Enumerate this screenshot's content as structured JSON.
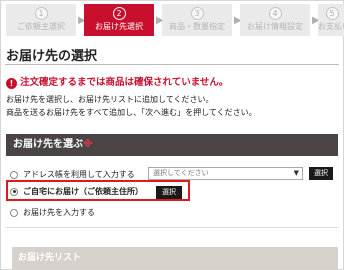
{
  "stepper": {
    "steps": [
      {
        "num": "1",
        "label": "ご依頼主選択"
      },
      {
        "num": "2",
        "label": "お届け先選択"
      },
      {
        "num": "3",
        "label": "商品・数量指定"
      },
      {
        "num": "4",
        "label": "お届け情報設定"
      },
      {
        "num": "5",
        "label": "お支払い方"
      }
    ],
    "active_index": 1
  },
  "page_title": "お届け先の選択",
  "warning": {
    "icon": "exclamation-icon",
    "text": "注文確定するまでは商品は確保されていません。"
  },
  "description": {
    "line1": "お届け先を選択し、お届け先リストに追加してください。",
    "line2": "商品を送るお届け先をすべて追加し、「次へ進む」を押してください。"
  },
  "select_section": {
    "title": "お届け先を選ぶ",
    "required_mark": "※"
  },
  "options": {
    "address_book": {
      "label": "アドレス帳を利用して入力する",
      "select_placeholder": "選択してください",
      "button": "選択"
    },
    "home": {
      "label": "ご自宅にお届け（ご依頼主住所）",
      "button": "選択",
      "checked": true
    },
    "manual": {
      "label": "お届け先を入力する"
    }
  },
  "list_section": {
    "title": "お届け先リスト"
  },
  "colors": {
    "accent": "#c8102e",
    "section_header": "#4a4444",
    "highlight_border": "#e01a1a",
    "list_header": "#d6d1ca"
  }
}
